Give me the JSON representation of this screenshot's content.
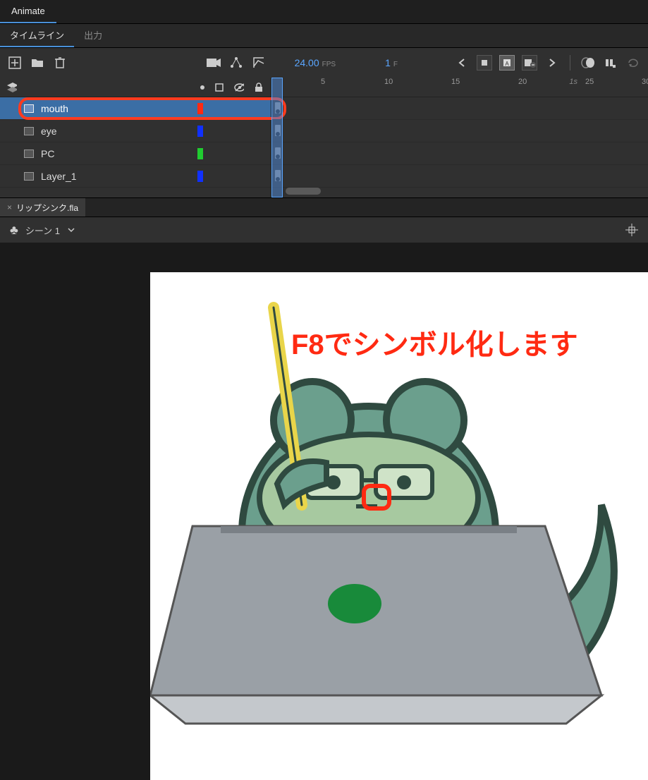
{
  "app": {
    "title": "Animate"
  },
  "panels": {
    "tabs": [
      "タイムライン",
      "出力"
    ],
    "active": 0
  },
  "playback": {
    "fps_value": "24.00",
    "fps_label": "FPS",
    "frame_value": "1",
    "frame_label": "F"
  },
  "ruler": {
    "ticks": [
      "5",
      "10",
      "15",
      "20",
      "25",
      "30"
    ],
    "time_label": "1s"
  },
  "layers": [
    {
      "name": "mouth",
      "color": "#ff2a12",
      "selected": true
    },
    {
      "name": "eye",
      "color": "#1030ff",
      "selected": false
    },
    {
      "name": "PC",
      "color": "#20cc30",
      "selected": false
    },
    {
      "name": "Layer_1",
      "color": "#1030ff",
      "selected": false
    }
  ],
  "document": {
    "file_tab": "リップシンク.fla",
    "scene": "シーン 1"
  },
  "annotation": {
    "text": "F8でシンボル化します"
  },
  "icons": {
    "club": "♣"
  }
}
